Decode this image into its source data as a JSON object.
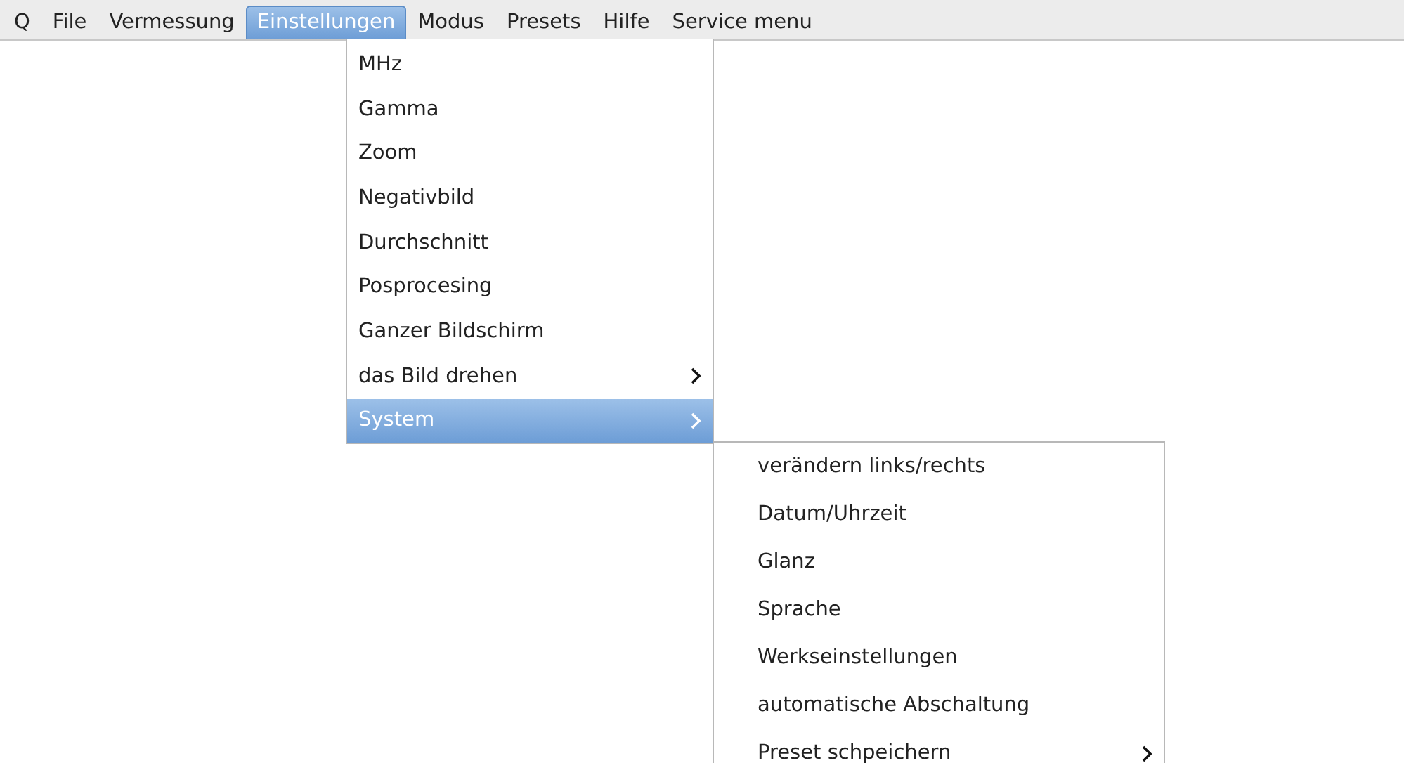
{
  "menubar": [
    {
      "label": "Q",
      "selected": false
    },
    {
      "label": "File",
      "selected": false
    },
    {
      "label": "Vermessung",
      "selected": false
    },
    {
      "label": "Einstellungen",
      "selected": true
    },
    {
      "label": "Modus",
      "selected": false
    },
    {
      "label": "Presets",
      "selected": false
    },
    {
      "label": "Hilfe",
      "selected": false
    },
    {
      "label": "Service menu",
      "selected": false
    }
  ],
  "menu": {
    "items": [
      {
        "label": "MHz",
        "selected": false,
        "submenu": false
      },
      {
        "label": "Gamma",
        "selected": false,
        "submenu": false
      },
      {
        "label": "Zoom",
        "selected": false,
        "submenu": false
      },
      {
        "label": "Negativbild",
        "selected": false,
        "submenu": false
      },
      {
        "label": "Durchschnitt",
        "selected": false,
        "submenu": false
      },
      {
        "label": "Posprocesing",
        "selected": false,
        "submenu": false
      },
      {
        "label": "Ganzer Bildschirm",
        "selected": false,
        "submenu": false
      },
      {
        "label": "das Bild drehen",
        "selected": false,
        "submenu": true
      },
      {
        "label": "System",
        "selected": true,
        "submenu": true
      }
    ]
  },
  "submenu": {
    "items": [
      {
        "label": "verändern links/rechts",
        "selected": false,
        "submenu": false
      },
      {
        "label": "Datum/Uhrzeit",
        "selected": false,
        "submenu": false
      },
      {
        "label": "Glanz",
        "selected": false,
        "submenu": false
      },
      {
        "label": "Sprache",
        "selected": false,
        "submenu": false
      },
      {
        "label": "Werkseinstellungen",
        "selected": false,
        "submenu": false
      },
      {
        "label": "automatische Abschaltung",
        "selected": false,
        "submenu": false
      },
      {
        "label": "Preset schpeichern",
        "selected": false,
        "submenu": true
      }
    ]
  }
}
